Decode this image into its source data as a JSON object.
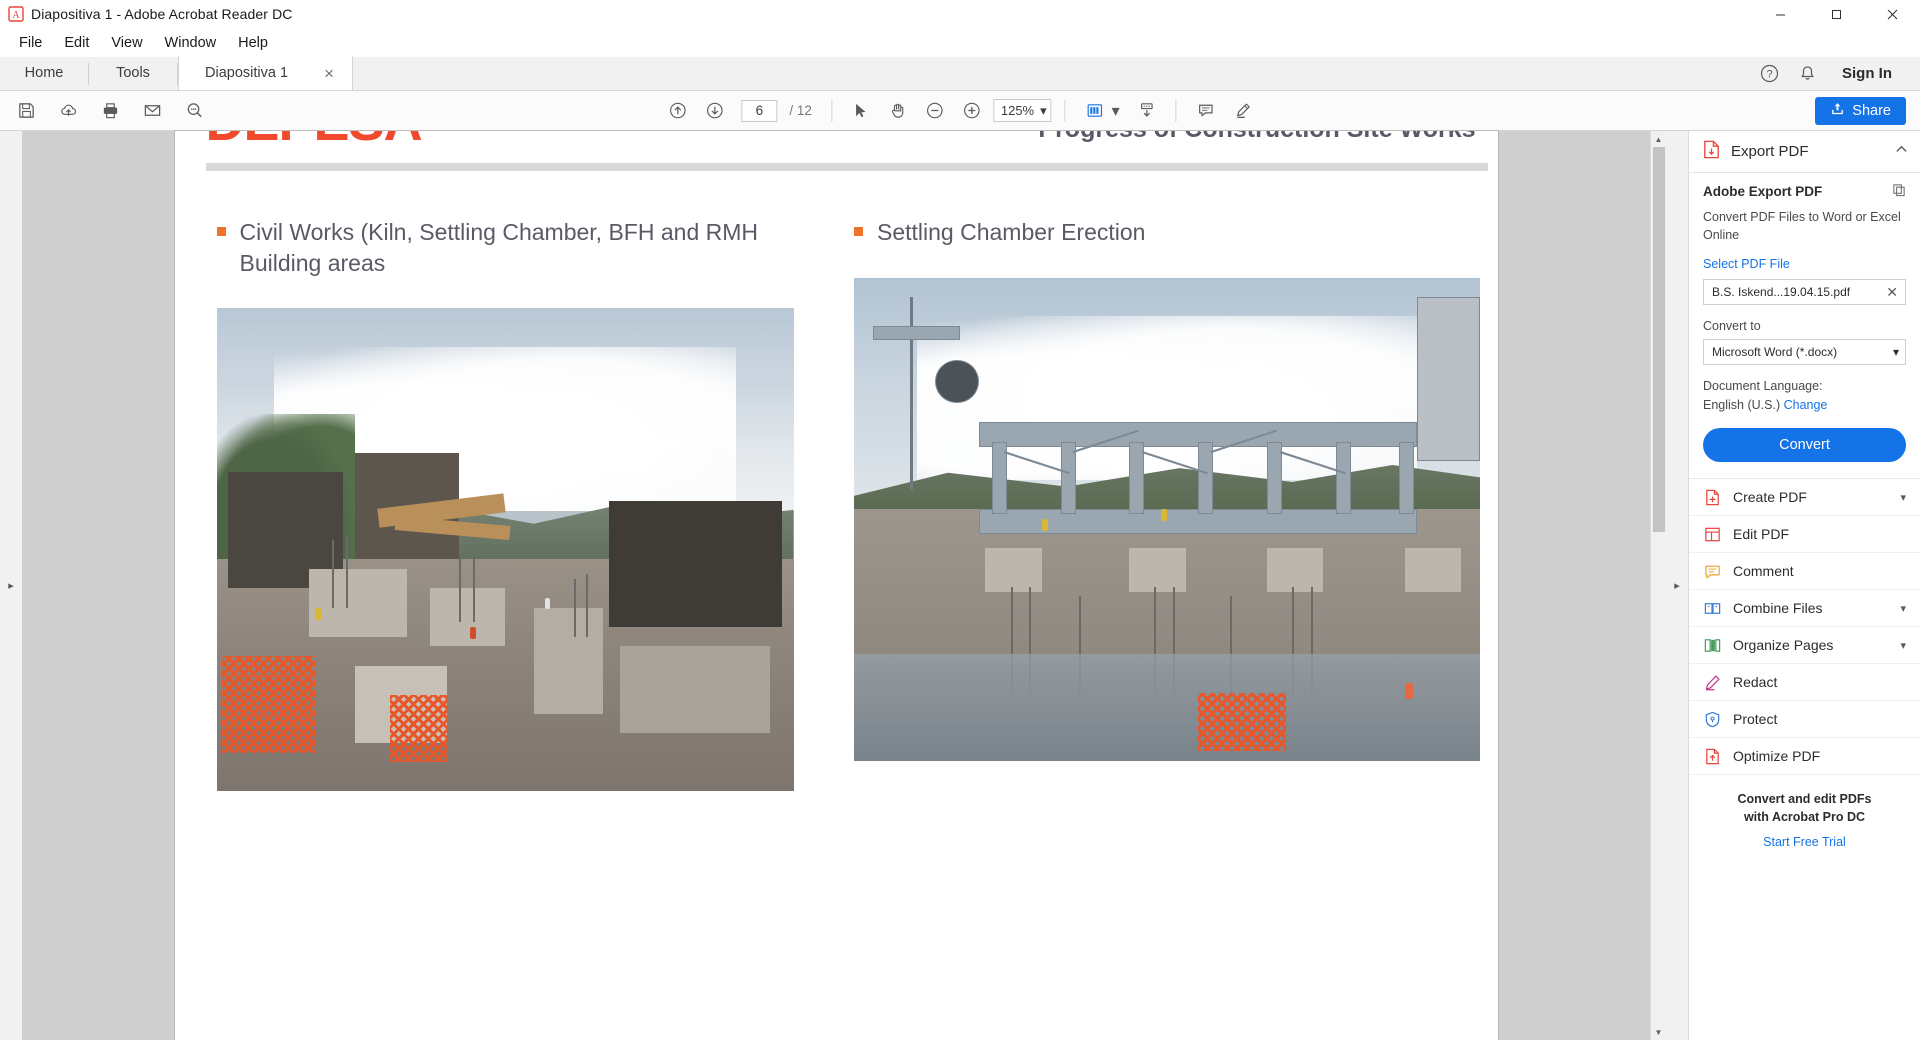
{
  "window": {
    "title": "Diapositiva 1 - Adobe Acrobat Reader DC",
    "app_icon": "acrobat-icon",
    "minimize": "minimize-icon",
    "maximize": "maximize-icon",
    "close": "close-icon"
  },
  "menu": {
    "items": [
      {
        "label": "File"
      },
      {
        "label": "Edit"
      },
      {
        "label": "View"
      },
      {
        "label": "Window"
      },
      {
        "label": "Help"
      }
    ]
  },
  "tabs": {
    "home": "Home",
    "tools": "Tools",
    "document": "Diapositiva 1",
    "close_glyph": "×",
    "help_icon": "help-icon",
    "bell_icon": "notification-bell-icon",
    "sign_in": "Sign In"
  },
  "toolbar": {
    "left_icons": [
      {
        "name": "save-icon"
      },
      {
        "name": "upload-cloud-icon"
      },
      {
        "name": "print-icon"
      },
      {
        "name": "email-icon"
      },
      {
        "name": "zoom-search-icon"
      }
    ],
    "page_up_icon": "page-up-icon",
    "page_down_icon": "page-down-icon",
    "page_number": "6",
    "page_total": "/ 12",
    "select_tool_icon": "select-cursor-icon",
    "hand_tool_icon": "hand-tool-icon",
    "zoom_out_icon": "zoom-out-icon",
    "zoom_in_icon": "zoom-in-icon",
    "zoom_value": "125%",
    "zoom_caret": "▾",
    "fit_page_icon": "fit-page-icon",
    "fit_caret": "▾",
    "scroll_mode_icon": "scroll-mode-icon",
    "comment_icon": "comment-icon",
    "highlight_icon": "highlight-pen-icon",
    "share_label": "Share",
    "share_icon": "share-icon",
    "share_color": "#1473e6"
  },
  "document": {
    "brand": "DEPESA",
    "brand_color": "#f1492b",
    "slide_title": "Progress of Construction Site Works",
    "bullets": [
      {
        "text": "Civil Works (Kiln, Settling Chamber, BFH and RMH Building areas"
      },
      {
        "text": "Settling Chamber Erection"
      }
    ],
    "bullet_color": "#f1722b",
    "photo_left_alt": "construction-site-civil-works-photo",
    "photo_right_alt": "settling-chamber-steel-erection-photo"
  },
  "scrollbar": {
    "up_glyph": "▲",
    "down_glyph": "▼"
  },
  "rails": {
    "left_glyph": "▸",
    "right_glyph": "▸"
  },
  "right_panel": {
    "header_title": "Export PDF",
    "header_icon": "export-pdf-icon",
    "collapse_glyph": "⌃",
    "section_title": "Adobe Export PDF",
    "section_icon": "copy-icon",
    "description": "Convert PDF Files to Word or Excel Online",
    "select_file_link": "Select PDF File",
    "file_name": "B.S. Iskend...19.04.15.pdf",
    "file_clear_glyph": "✕",
    "convert_to_label": "Convert to",
    "convert_to_value": "Microsoft Word (*.docx)",
    "select_caret": "▾",
    "doc_language_label": "Document Language:",
    "doc_language_value": "English (U.S.)",
    "doc_language_change": "Change",
    "convert_button": "Convert",
    "accent_color": "#1473e6",
    "tools": [
      {
        "label": "Create PDF",
        "icon": "create-pdf-icon",
        "caret": "▾",
        "color": "#e8463c"
      },
      {
        "label": "Edit PDF",
        "icon": "edit-pdf-icon",
        "caret": "",
        "color": "#e8463c"
      },
      {
        "label": "Comment",
        "icon": "comment-tool-icon",
        "caret": "",
        "color": "#f2a93b"
      },
      {
        "label": "Combine Files",
        "icon": "combine-files-icon",
        "caret": "▾",
        "color": "#3b7fd4"
      },
      {
        "label": "Organize Pages",
        "icon": "organize-pages-icon",
        "caret": "▾",
        "color": "#4a9e5c"
      },
      {
        "label": "Redact",
        "icon": "redact-icon",
        "caret": "",
        "color": "#c93b8e"
      },
      {
        "label": "Protect",
        "icon": "protect-shield-icon",
        "caret": "",
        "color": "#3b7fd4"
      },
      {
        "label": "Optimize PDF",
        "icon": "optimize-pdf-icon",
        "caret": "",
        "color": "#e8463c"
      }
    ],
    "promo_line1": "Convert and edit PDFs",
    "promo_line2": "with Acrobat Pro DC",
    "promo_link": "Start Free Trial"
  }
}
